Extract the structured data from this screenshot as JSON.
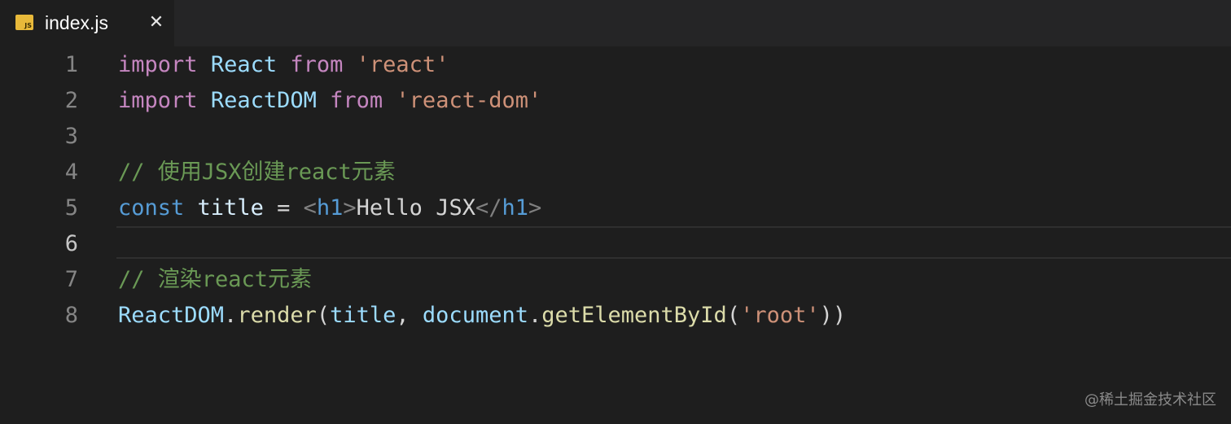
{
  "tab": {
    "title": "index.js",
    "icon_label": "JS",
    "icon": "js-file-icon",
    "close_icon": "close-icon",
    "close_glyph": "✕"
  },
  "editor": {
    "active_line": 6,
    "lines": [
      {
        "number": "1",
        "tokens": [
          {
            "text": "import",
            "type": "keyword"
          },
          {
            "text": " ",
            "type": "plain"
          },
          {
            "text": "React",
            "type": "variable"
          },
          {
            "text": " ",
            "type": "plain"
          },
          {
            "text": "from",
            "type": "keyword"
          },
          {
            "text": " ",
            "type": "plain"
          },
          {
            "text": "'react'",
            "type": "string"
          }
        ]
      },
      {
        "number": "2",
        "tokens": [
          {
            "text": "import",
            "type": "keyword"
          },
          {
            "text": " ",
            "type": "plain"
          },
          {
            "text": "ReactDOM",
            "type": "variable"
          },
          {
            "text": " ",
            "type": "plain"
          },
          {
            "text": "from",
            "type": "keyword"
          },
          {
            "text": " ",
            "type": "plain"
          },
          {
            "text": "'react-dom'",
            "type": "string"
          }
        ]
      },
      {
        "number": "3",
        "tokens": []
      },
      {
        "number": "4",
        "tokens": [
          {
            "text": "// 使用JSX创建react元素",
            "type": "comment"
          }
        ]
      },
      {
        "number": "5",
        "tokens": [
          {
            "text": "const",
            "type": "storage"
          },
          {
            "text": " ",
            "type": "plain"
          },
          {
            "text": "title",
            "type": "constant"
          },
          {
            "text": " = ",
            "type": "plain"
          },
          {
            "text": "<",
            "type": "punct"
          },
          {
            "text": "h1",
            "type": "tag"
          },
          {
            "text": ">",
            "type": "punct"
          },
          {
            "text": "Hello JSX",
            "type": "plain"
          },
          {
            "text": "</",
            "type": "punct"
          },
          {
            "text": "h1",
            "type": "tag"
          },
          {
            "text": ">",
            "type": "punct"
          }
        ]
      },
      {
        "number": "6",
        "tokens": []
      },
      {
        "number": "7",
        "tokens": [
          {
            "text": "// 渲染react元素",
            "type": "comment"
          }
        ]
      },
      {
        "number": "8",
        "tokens": [
          {
            "text": "ReactDOM",
            "type": "variable"
          },
          {
            "text": ".",
            "type": "plain"
          },
          {
            "text": "render",
            "type": "function"
          },
          {
            "text": "(",
            "type": "plain"
          },
          {
            "text": "title",
            "type": "variable"
          },
          {
            "text": ", ",
            "type": "plain"
          },
          {
            "text": "document",
            "type": "variable"
          },
          {
            "text": ".",
            "type": "plain"
          },
          {
            "text": "getElementById",
            "type": "function"
          },
          {
            "text": "(",
            "type": "plain"
          },
          {
            "text": "'root'",
            "type": "string"
          },
          {
            "text": "))",
            "type": "plain"
          }
        ]
      }
    ]
  },
  "watermark": "@稀土掘金技术社区",
  "colors": {
    "keyword": "#c586c0",
    "variable": "#9cdcfe",
    "string": "#ce9178",
    "comment": "#6a9955",
    "storage": "#569cd6",
    "constant": "#d8eefe",
    "punct": "#808080",
    "tag": "#569cd6",
    "function": "#dcdcaa",
    "plain": "#d4d4d4"
  }
}
